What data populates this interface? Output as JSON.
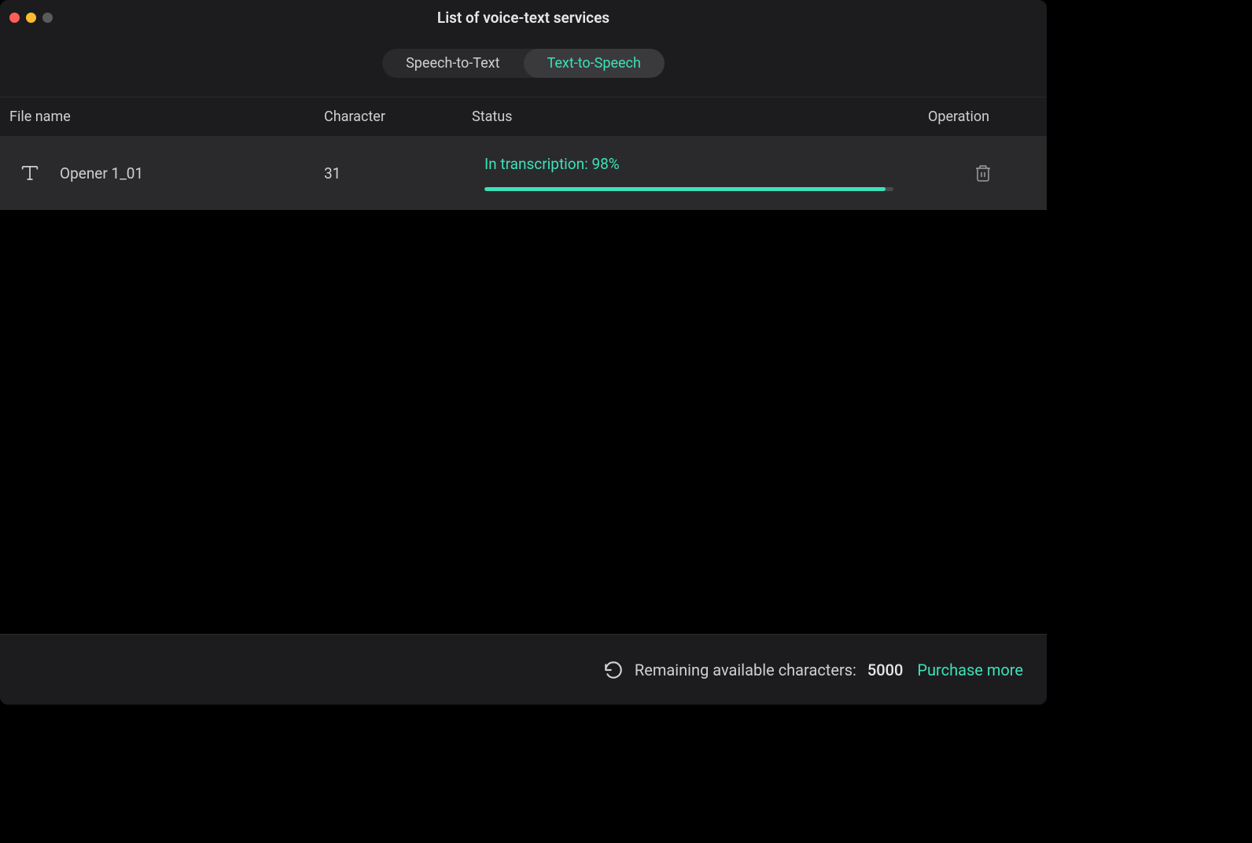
{
  "window": {
    "title": "List of voice-text services"
  },
  "tabs": {
    "speech_to_text": "Speech-to-Text",
    "text_to_speech": "Text-to-Speech"
  },
  "columns": {
    "filename": "File name",
    "character": "Character",
    "status": "Status",
    "operation": "Operation"
  },
  "rows": [
    {
      "filename": "Opener 1_01",
      "character": "31",
      "status_text": "In transcription: 98%",
      "progress_percent": 98
    }
  ],
  "footer": {
    "remaining_label": "Remaining available characters:",
    "remaining_count": "5000",
    "purchase_label": "Purchase more"
  }
}
